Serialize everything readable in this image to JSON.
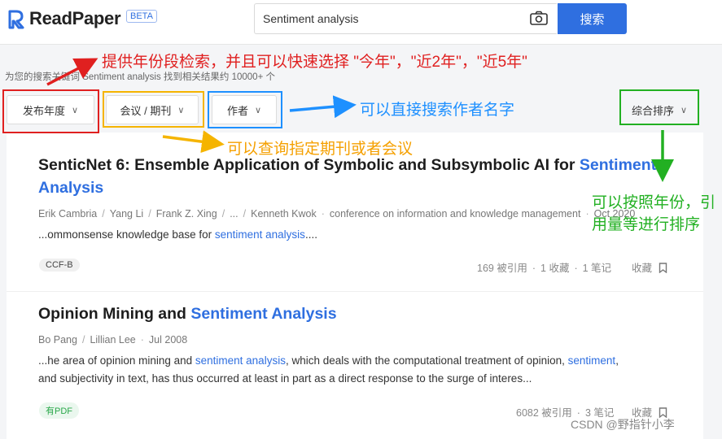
{
  "header": {
    "logo_text": "ReadPaper",
    "beta": "BETA",
    "search_value": "Sentiment analysis",
    "search_button": "搜索"
  },
  "summary": "为您的搜索关键词 Sentiment analysis 找到相关结果约 10000+ 个",
  "filters": {
    "year": "发布年度",
    "venue": "会议 / 期刊",
    "author": "作者",
    "sort": "综合排序"
  },
  "annotations": {
    "year": "提供年份段检索，并且可以快速选择 \"今年\"，\"近2年\"，\"近5年\"",
    "author": "可以直接搜索作者名字",
    "venue": "可以查询指定期刊或者会议",
    "sort": "可以按照年份，引用量等进行排序",
    "colors": {
      "red": "#e02020",
      "orange": "#f5b400",
      "blue": "#1e90ff",
      "green": "#22b022"
    }
  },
  "results": [
    {
      "title_plain": "SenticNet 6: Ensemble Application of Symbolic and Subsymbolic AI for ",
      "title_hl_1": "Sentiment",
      "title_hl_2": "Analysis",
      "authors": [
        "Erik Cambria",
        "Yang Li",
        "Frank Z. Xing",
        "...",
        "Kenneth Kwok"
      ],
      "venue": "conference on information and knowledge management",
      "date": "Oct 2020",
      "snippet_pre": "...ommonsense knowledge base for ",
      "snippet_hl": "sentiment analysis",
      "snippet_post": "....",
      "tag": "CCF-B",
      "citations": "169 被引用",
      "favorites": "1 收藏",
      "notes": "1 笔记",
      "save": "收藏"
    },
    {
      "title_plain": "Opinion Mining and ",
      "title_hl": "Sentiment Analysis",
      "authors": [
        "Bo Pang",
        "Lillian Lee"
      ],
      "date": "Jul 2008",
      "snippet_1_pre": "...he area of opinion mining and ",
      "snippet_1_hl": "sentiment analysis",
      "snippet_1_mid": ", which deals with the computational treatment of opinion, ",
      "snippet_1_hl2": "sentiment",
      "snippet_1_post": ",",
      "snippet_2": "and subjectivity in text, has thus occurred at least in part as a direct response to the surge of interes...",
      "tag": "有PDF",
      "citations": "6082 被引用",
      "favorites": "3 笔记",
      "save": "收藏"
    }
  ],
  "watermark": "CSDN @野指针小李"
}
